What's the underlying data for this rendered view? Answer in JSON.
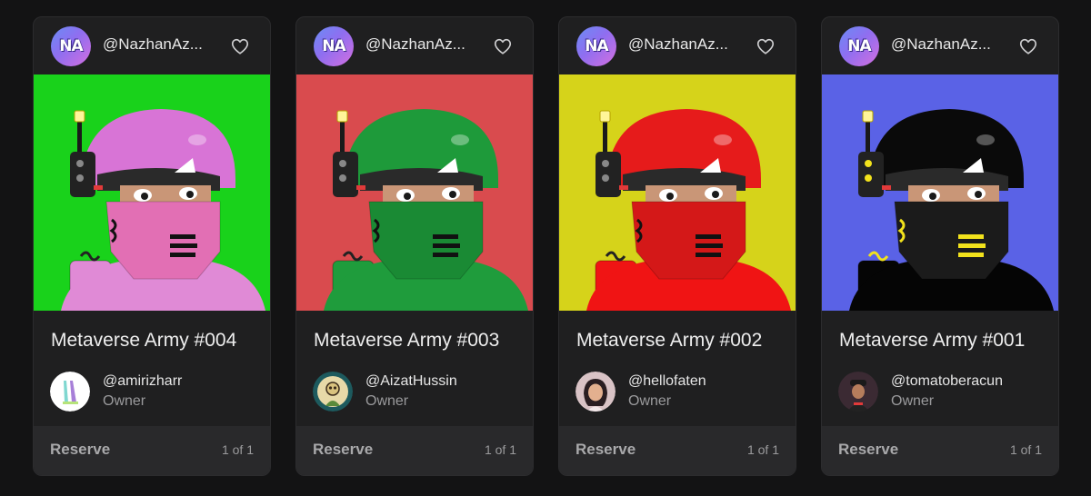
{
  "cards": [
    {
      "creator_initials": "NA",
      "creator_handle": "@NazhanAz...",
      "title": "Metaverse Army #004",
      "owner_handle": "@amirizharr",
      "owner_label": "Owner",
      "action_label": "Reserve",
      "edition": "1 of 1",
      "colors": {
        "background": "#19d21b",
        "helmet": "#d874d6",
        "mask": "#e26fb4",
        "body": "#e08ad6",
        "accent": "#111111"
      }
    },
    {
      "creator_initials": "NA",
      "creator_handle": "@NazhanAz...",
      "title": "Metaverse Army #003",
      "owner_handle": "@AizatHussin",
      "owner_label": "Owner",
      "action_label": "Reserve",
      "edition": "1 of 1",
      "colors": {
        "background": "#d94b4e",
        "helmet": "#1e9a3a",
        "mask": "#1a8a34",
        "body": "#1f9c3c",
        "accent": "#111111"
      }
    },
    {
      "creator_initials": "NA",
      "creator_handle": "@NazhanAz...",
      "title": "Metaverse Army #002",
      "owner_handle": "@hellofaten",
      "owner_label": "Owner",
      "action_label": "Reserve",
      "edition": "1 of 1",
      "colors": {
        "background": "#d6d31a",
        "helmet": "#e61b1b",
        "mask": "#d41818",
        "body": "#f01414",
        "accent": "#111111"
      }
    },
    {
      "creator_initials": "NA",
      "creator_handle": "@NazhanAz...",
      "title": "Metaverse Army #001",
      "owner_handle": "@tomatoberacun",
      "owner_label": "Owner",
      "action_label": "Reserve",
      "edition": "1 of 1",
      "colors": {
        "background": "#5a62e6",
        "helmet": "#0a0a0a",
        "mask": "#1b1b1b",
        "body": "#050505",
        "accent": "#f2e21c"
      }
    }
  ],
  "icons": {
    "favorite": "heart-outline-icon"
  }
}
